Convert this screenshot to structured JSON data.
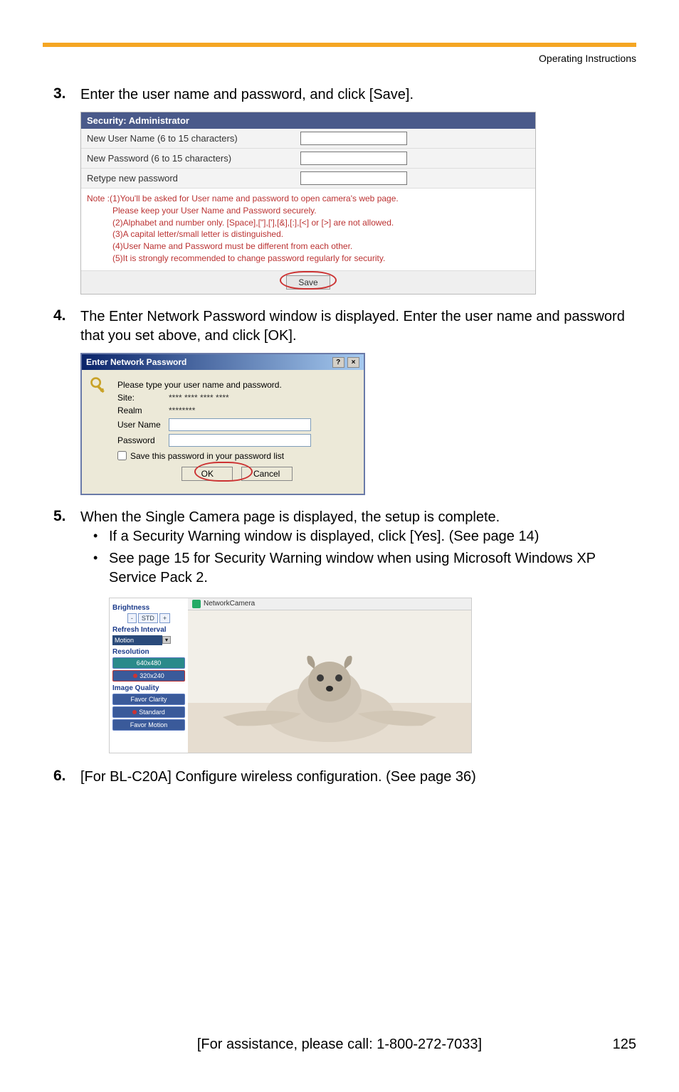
{
  "header": {
    "section": "Operating Instructions"
  },
  "steps": {
    "s3": {
      "num": "3.",
      "text": "Enter the user name and password, and click [Save]."
    },
    "s4": {
      "num": "4.",
      "text": "The Enter Network Password window is displayed. Enter the user name and password that you set above, and click [OK]."
    },
    "s5": {
      "num": "5.",
      "text": "When the Single Camera page is displayed, the setup is complete.",
      "b1": "If a Security Warning window is displayed, click [Yes]. (See page 14)",
      "b2": "See page 15 for Security Warning window when using Microsoft Windows XP Service Pack 2."
    },
    "s6": {
      "num": "6.",
      "text": "[For BL-C20A] Configure wireless configuration. (See page 36)"
    }
  },
  "securityBox": {
    "title": "Security: Administrator",
    "row1": "New User Name (6 to 15 characters)",
    "row2": "New Password (6 to 15 characters)",
    "row3": "Retype new password",
    "note1": "Note :(1)You'll be asked for User name and password to open camera's web page.",
    "note1b": "Please keep your User Name and Password securely.",
    "note2": "(2)Alphabet and number only. [Space],[\"],['],[&],[:],[<] or [>] are not allowed.",
    "note3": "(3)A capital letter/small letter is distinguished.",
    "note4": "(4)User Name and Password must be different from each other.",
    "note5": "(5)It is strongly recommended to change password regularly for security.",
    "save": "Save"
  },
  "npDialog": {
    "title": "Enter Network Password",
    "help_icon": "?",
    "close_icon": "×",
    "intro": "Please type your user name and password.",
    "siteLabel": "Site:",
    "siteValue": "**** **** **** ****",
    "realmLabel": "Realm",
    "realmValue": "********",
    "userLabel": "User Name",
    "passLabel": "Password",
    "saveCheck": "Save this password in your password list",
    "ok": "OK",
    "cancel": "Cancel"
  },
  "camPanel": {
    "tabLabel": "NetworkCamera",
    "brightness": "Brightness",
    "std_minus": "-",
    "std": "STD",
    "std_plus": "+",
    "refresh": "Refresh Interval",
    "motion": "Motion",
    "resolution": "Resolution",
    "res1": "640x480",
    "res2": "320x240",
    "imgq": "Image Quality",
    "favorClarity": "Favor Clarity",
    "standard": "Standard",
    "favorMotion": "Favor Motion"
  },
  "footer": {
    "assist": "[For assistance, please call: 1-800-272-7033]",
    "page": "125"
  }
}
